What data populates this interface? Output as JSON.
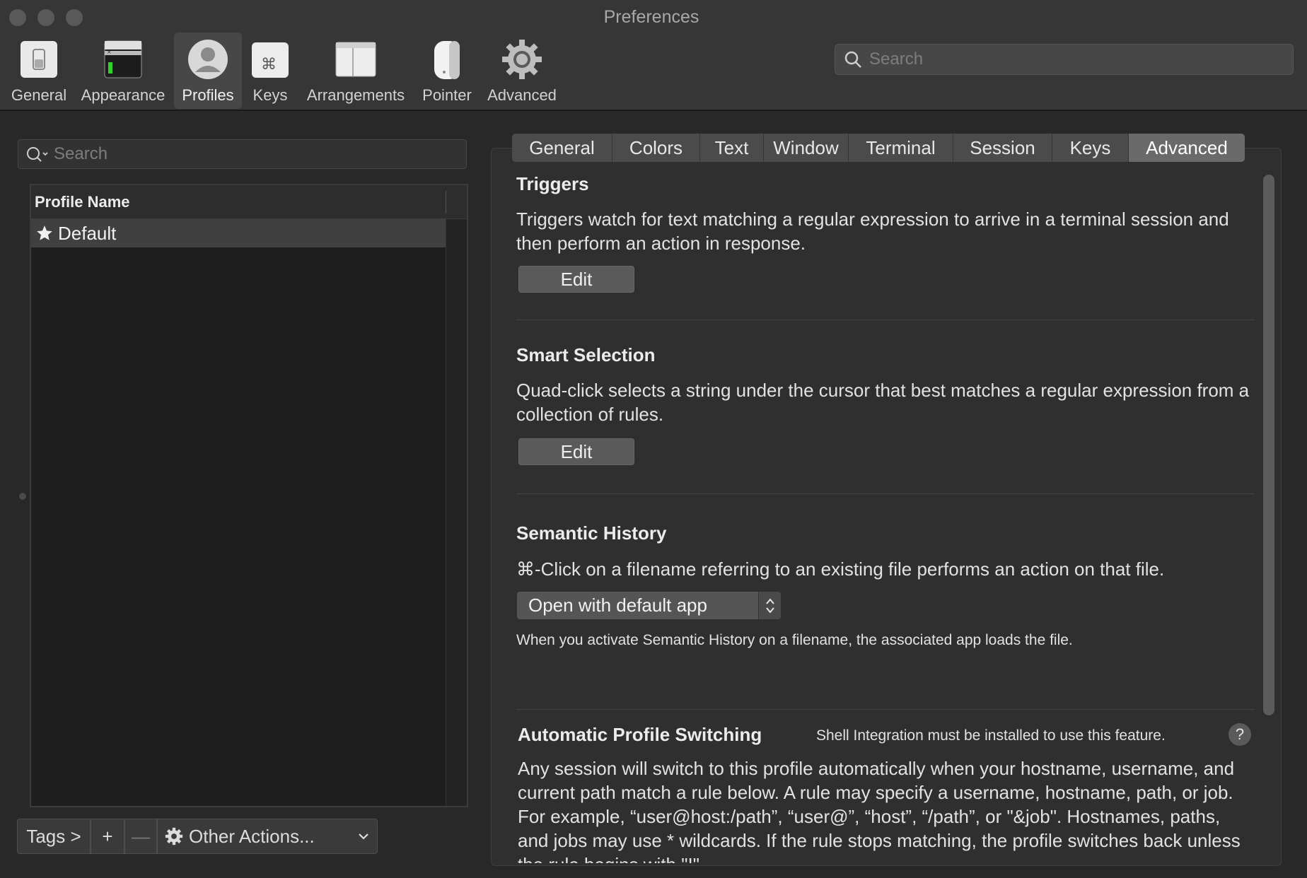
{
  "window": {
    "title": "Preferences"
  },
  "toolbar": {
    "items": [
      {
        "label": "General",
        "icon": "general-switch-icon"
      },
      {
        "label": "Appearance",
        "icon": "appearance-window-icon"
      },
      {
        "label": "Profiles",
        "icon": "profiles-person-icon",
        "active": true
      },
      {
        "label": "Keys",
        "icon": "keys-command-icon"
      },
      {
        "label": "Arrangements",
        "icon": "arrangements-windows-icon"
      },
      {
        "label": "Pointer",
        "icon": "pointer-mouse-icon"
      },
      {
        "label": "Advanced",
        "icon": "advanced-gear-icon"
      }
    ],
    "search_placeholder": "Search"
  },
  "profiles": {
    "search_placeholder": "Search",
    "column_header": "Profile Name",
    "rows": [
      {
        "name": "Default",
        "default": true,
        "selected": true
      }
    ],
    "bottom": {
      "tags": "Tags >",
      "add": "+",
      "remove": "—",
      "other_actions": "Other Actions..."
    }
  },
  "tabs": [
    {
      "label": "General"
    },
    {
      "label": "Colors"
    },
    {
      "label": "Text"
    },
    {
      "label": "Window"
    },
    {
      "label": "Terminal"
    },
    {
      "label": "Session"
    },
    {
      "label": "Keys"
    },
    {
      "label": "Advanced",
      "active": true
    }
  ],
  "advanced": {
    "triggers": {
      "title": "Triggers",
      "description": "Triggers watch for text matching a regular expression to arrive in a terminal session and then perform an action in response.",
      "button": "Edit"
    },
    "smart_selection": {
      "title": "Smart Selection",
      "description": "Quad-click selects a string under the cursor that best matches a regular expression from a collection of rules.",
      "button": "Edit"
    },
    "semantic_history": {
      "title": "Semantic History",
      "description": "⌘-Click on a filename referring to an existing file performs an action on that file.",
      "selected_action": "Open with default app",
      "note": "When you activate Semantic History on a filename, the associated app loads the file."
    },
    "auto_profile_switching": {
      "title": "Automatic Profile Switching",
      "note": "Shell Integration must be installed to use this feature.",
      "help": "?",
      "description": "Any session will switch to this profile automatically when your hostname, username, and current path match a rule below. A rule may specify a username, hostname, path, or job. For example, “user@host:/path”, “user@”, “host”, “/path”, or \"&job\". Hostnames, paths, and jobs may use * wildcards. If the rule stops matching, the profile switches back unless the rule begins with \"!\"."
    }
  },
  "colors": {
    "background": "#282828",
    "panel": "#2f2f2f",
    "selected_tab": "#6a6a6a",
    "text": "#e6e6e6"
  }
}
